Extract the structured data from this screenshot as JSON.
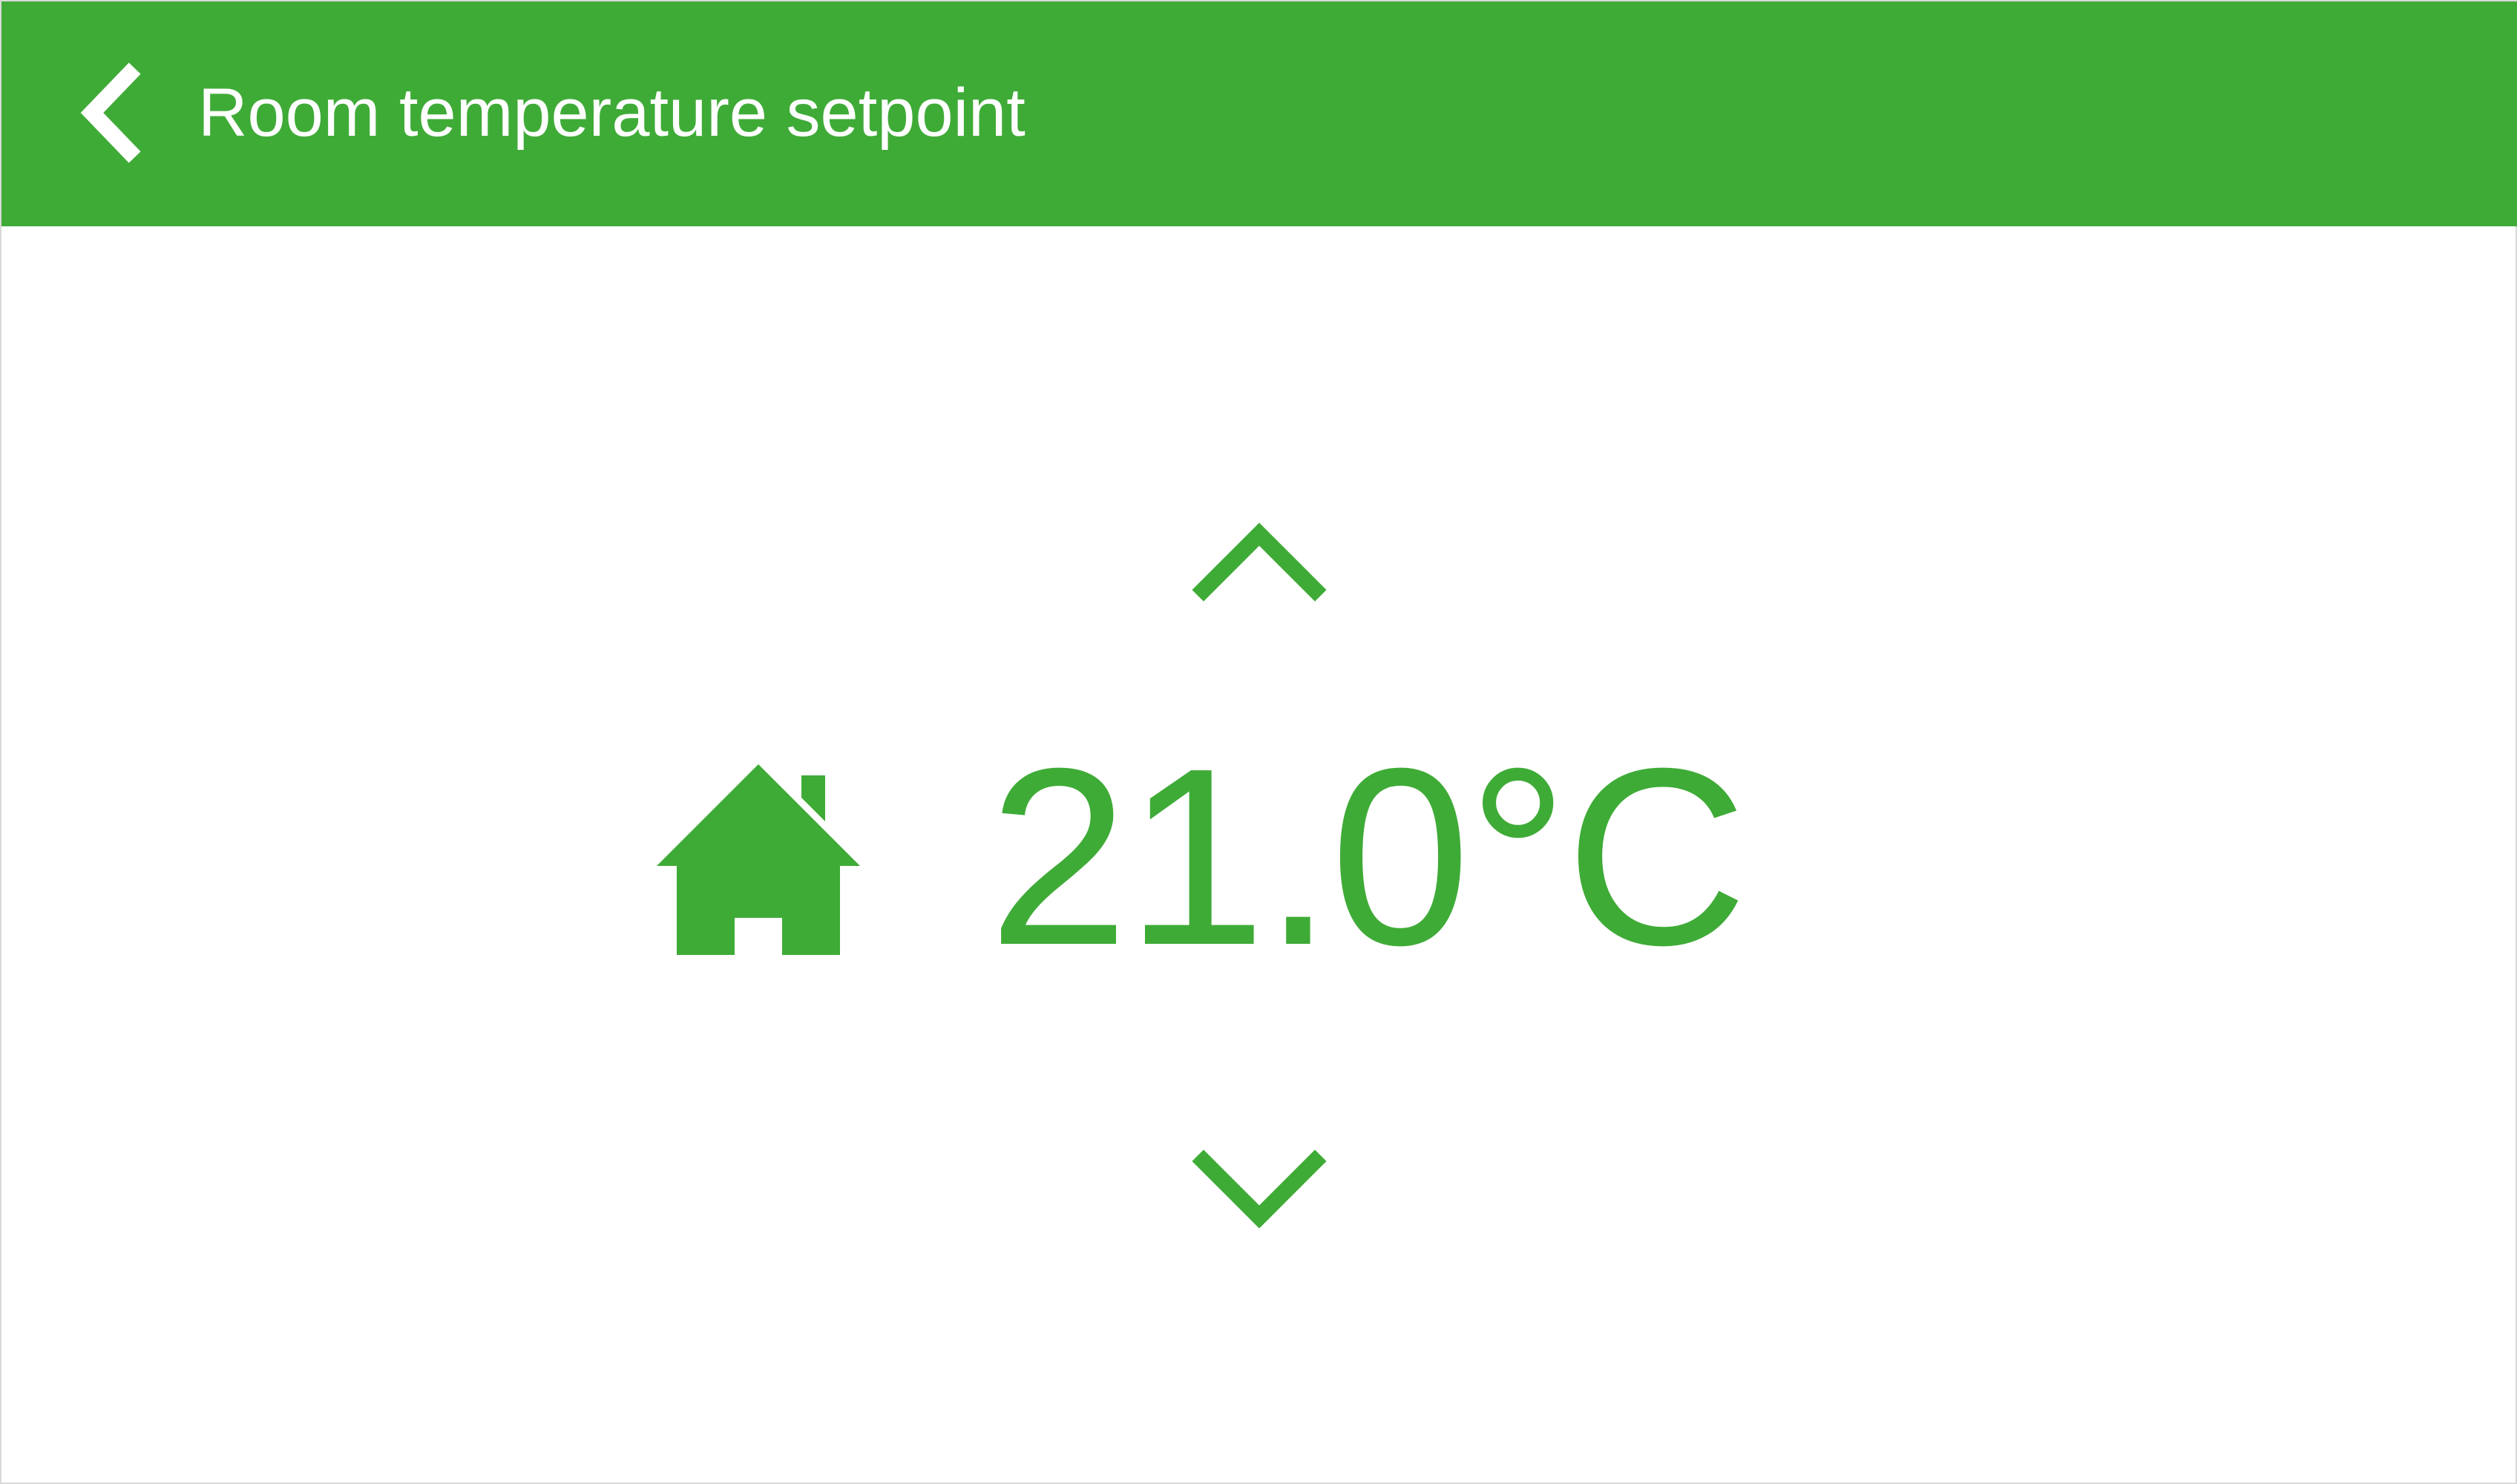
{
  "header": {
    "back_icon": "chevron-left-icon",
    "title": "Room temperature setpoint"
  },
  "setpoint": {
    "mode_icon": "home-icon",
    "value": "21.0",
    "unit": "°C",
    "increase_icon": "chevron-up-icon",
    "decrease_icon": "chevron-down-icon"
  },
  "colors": {
    "accent": "#3fab37",
    "header_text": "#ffffff",
    "background": "#ffffff"
  }
}
